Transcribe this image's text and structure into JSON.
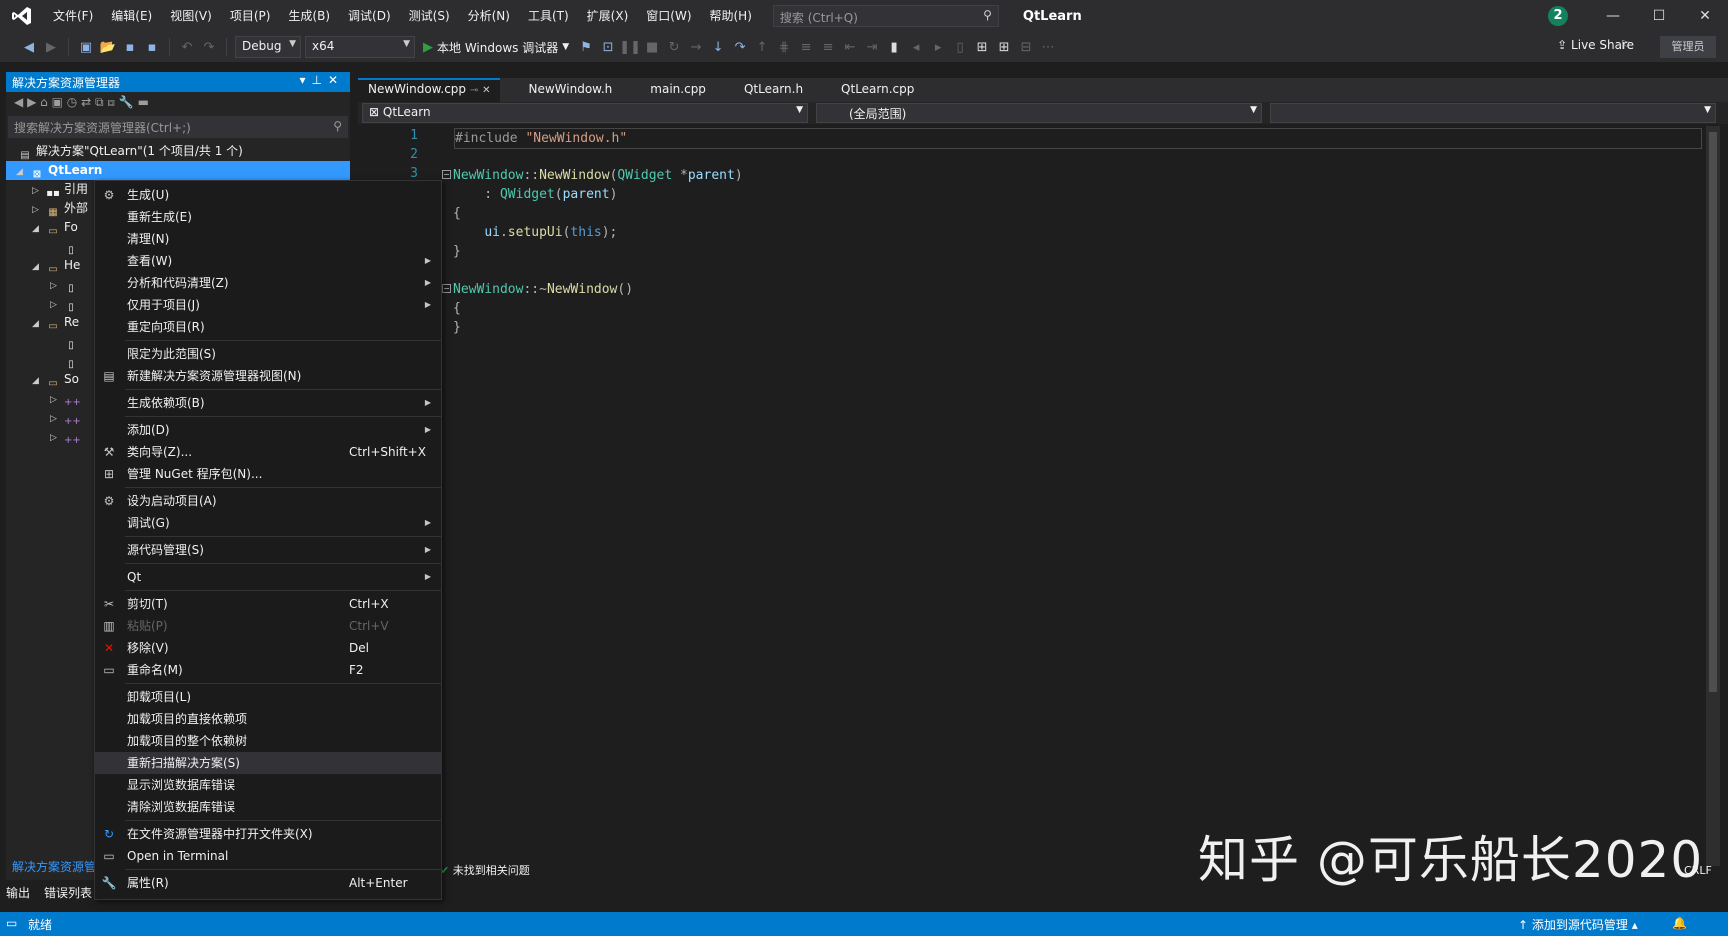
{
  "titlebar": {
    "menus": [
      "文件(F)",
      "编辑(E)",
      "视图(V)",
      "项目(P)",
      "生成(B)",
      "调试(D)",
      "测试(S)",
      "分析(N)",
      "工具(T)",
      "扩展(X)",
      "窗口(W)",
      "帮助(H)"
    ],
    "search_placeholder": "搜索 (Ctrl+Q)",
    "title": "QtLearn",
    "notif_count": "2"
  },
  "toolbar": {
    "config": "Debug",
    "platform": "x64",
    "run_label": "本地 Windows 调试器",
    "liveshare": "Live Share",
    "admin": "管理员"
  },
  "solution": {
    "header": "解决方案资源管理器",
    "search_placeholder": "搜索解决方案资源管理器(Ctrl+;)",
    "solution_label": "解决方案\"QtLearn\"(1 个项目/共 1 个)",
    "project_label": "QtLearn",
    "items": [
      "引用",
      "外部",
      "Fo",
      "He",
      "Re",
      "So"
    ],
    "footer": "解决方案资源管"
  },
  "bottom_tabs": [
    "输出",
    "错误列表"
  ],
  "editor": {
    "tabs": [
      "NewWindow.cpp",
      "NewWindow.h",
      "main.cpp",
      "QtLearn.h",
      "QtLearn.cpp"
    ],
    "nav_project": "QtLearn",
    "nav_scope": "(全局范围)",
    "status": "未找到相关问题"
  },
  "context_menu": {
    "items": [
      {
        "label": "生成(U)",
        "icon": "build-icon"
      },
      {
        "label": "重新生成(E)"
      },
      {
        "label": "清理(N)"
      },
      {
        "label": "查看(W)",
        "submenu": true
      },
      {
        "label": "分析和代码清理(Z)",
        "submenu": true
      },
      {
        "label": "仅用于项目(J)",
        "submenu": true
      },
      {
        "label": "重定向项目(R)"
      },
      {
        "sep": true
      },
      {
        "label": "限定为此范围(S)"
      },
      {
        "label": "新建解决方案资源管理器视图(N)",
        "icon": "new-view-icon"
      },
      {
        "sep": true
      },
      {
        "label": "生成依赖项(B)",
        "submenu": true
      },
      {
        "sep": true
      },
      {
        "label": "添加(D)",
        "submenu": true
      },
      {
        "label": "类向导(Z)...",
        "shortcut": "Ctrl+Shift+X",
        "icon": "class-wizard-icon"
      },
      {
        "label": "管理 NuGet 程序包(N)...",
        "icon": "nuget-icon"
      },
      {
        "sep": true
      },
      {
        "label": "设为启动项目(A)",
        "icon": "gear-icon"
      },
      {
        "label": "调试(G)",
        "submenu": true
      },
      {
        "sep": true
      },
      {
        "label": "源代码管理(S)",
        "submenu": true
      },
      {
        "sep": true
      },
      {
        "label": "Qt",
        "submenu": true
      },
      {
        "sep": true
      },
      {
        "label": "剪切(T)",
        "shortcut": "Ctrl+X",
        "icon": "cut-icon"
      },
      {
        "label": "粘贴(P)",
        "shortcut": "Ctrl+V",
        "icon": "paste-icon",
        "disabled": true
      },
      {
        "label": "移除(V)",
        "shortcut": "Del",
        "icon": "remove-icon"
      },
      {
        "label": "重命名(M)",
        "shortcut": "F2",
        "icon": "rename-icon"
      },
      {
        "sep": true
      },
      {
        "label": "卸载项目(L)"
      },
      {
        "label": "加载项目的直接依赖项"
      },
      {
        "label": "加载项目的整个依赖树"
      },
      {
        "label": "重新扫描解决方案(S)",
        "highlighted": true
      },
      {
        "label": "显示浏览数据库错误"
      },
      {
        "label": "清除浏览数据库错误"
      },
      {
        "sep": true
      },
      {
        "label": "在文件资源管理器中打开文件夹(X)",
        "icon": "open-folder-icon"
      },
      {
        "label": "Open in Terminal",
        "icon": "terminal-icon"
      },
      {
        "sep": true
      },
      {
        "label": "属性(R)",
        "shortcut": "Alt+Enter",
        "icon": "wrench-icon"
      }
    ]
  },
  "statusbar": {
    "ready": "就绪",
    "source_control": "添加到源代码管理",
    "line_ending": "CRLF"
  },
  "watermark": "知乎 @可乐船长2020"
}
